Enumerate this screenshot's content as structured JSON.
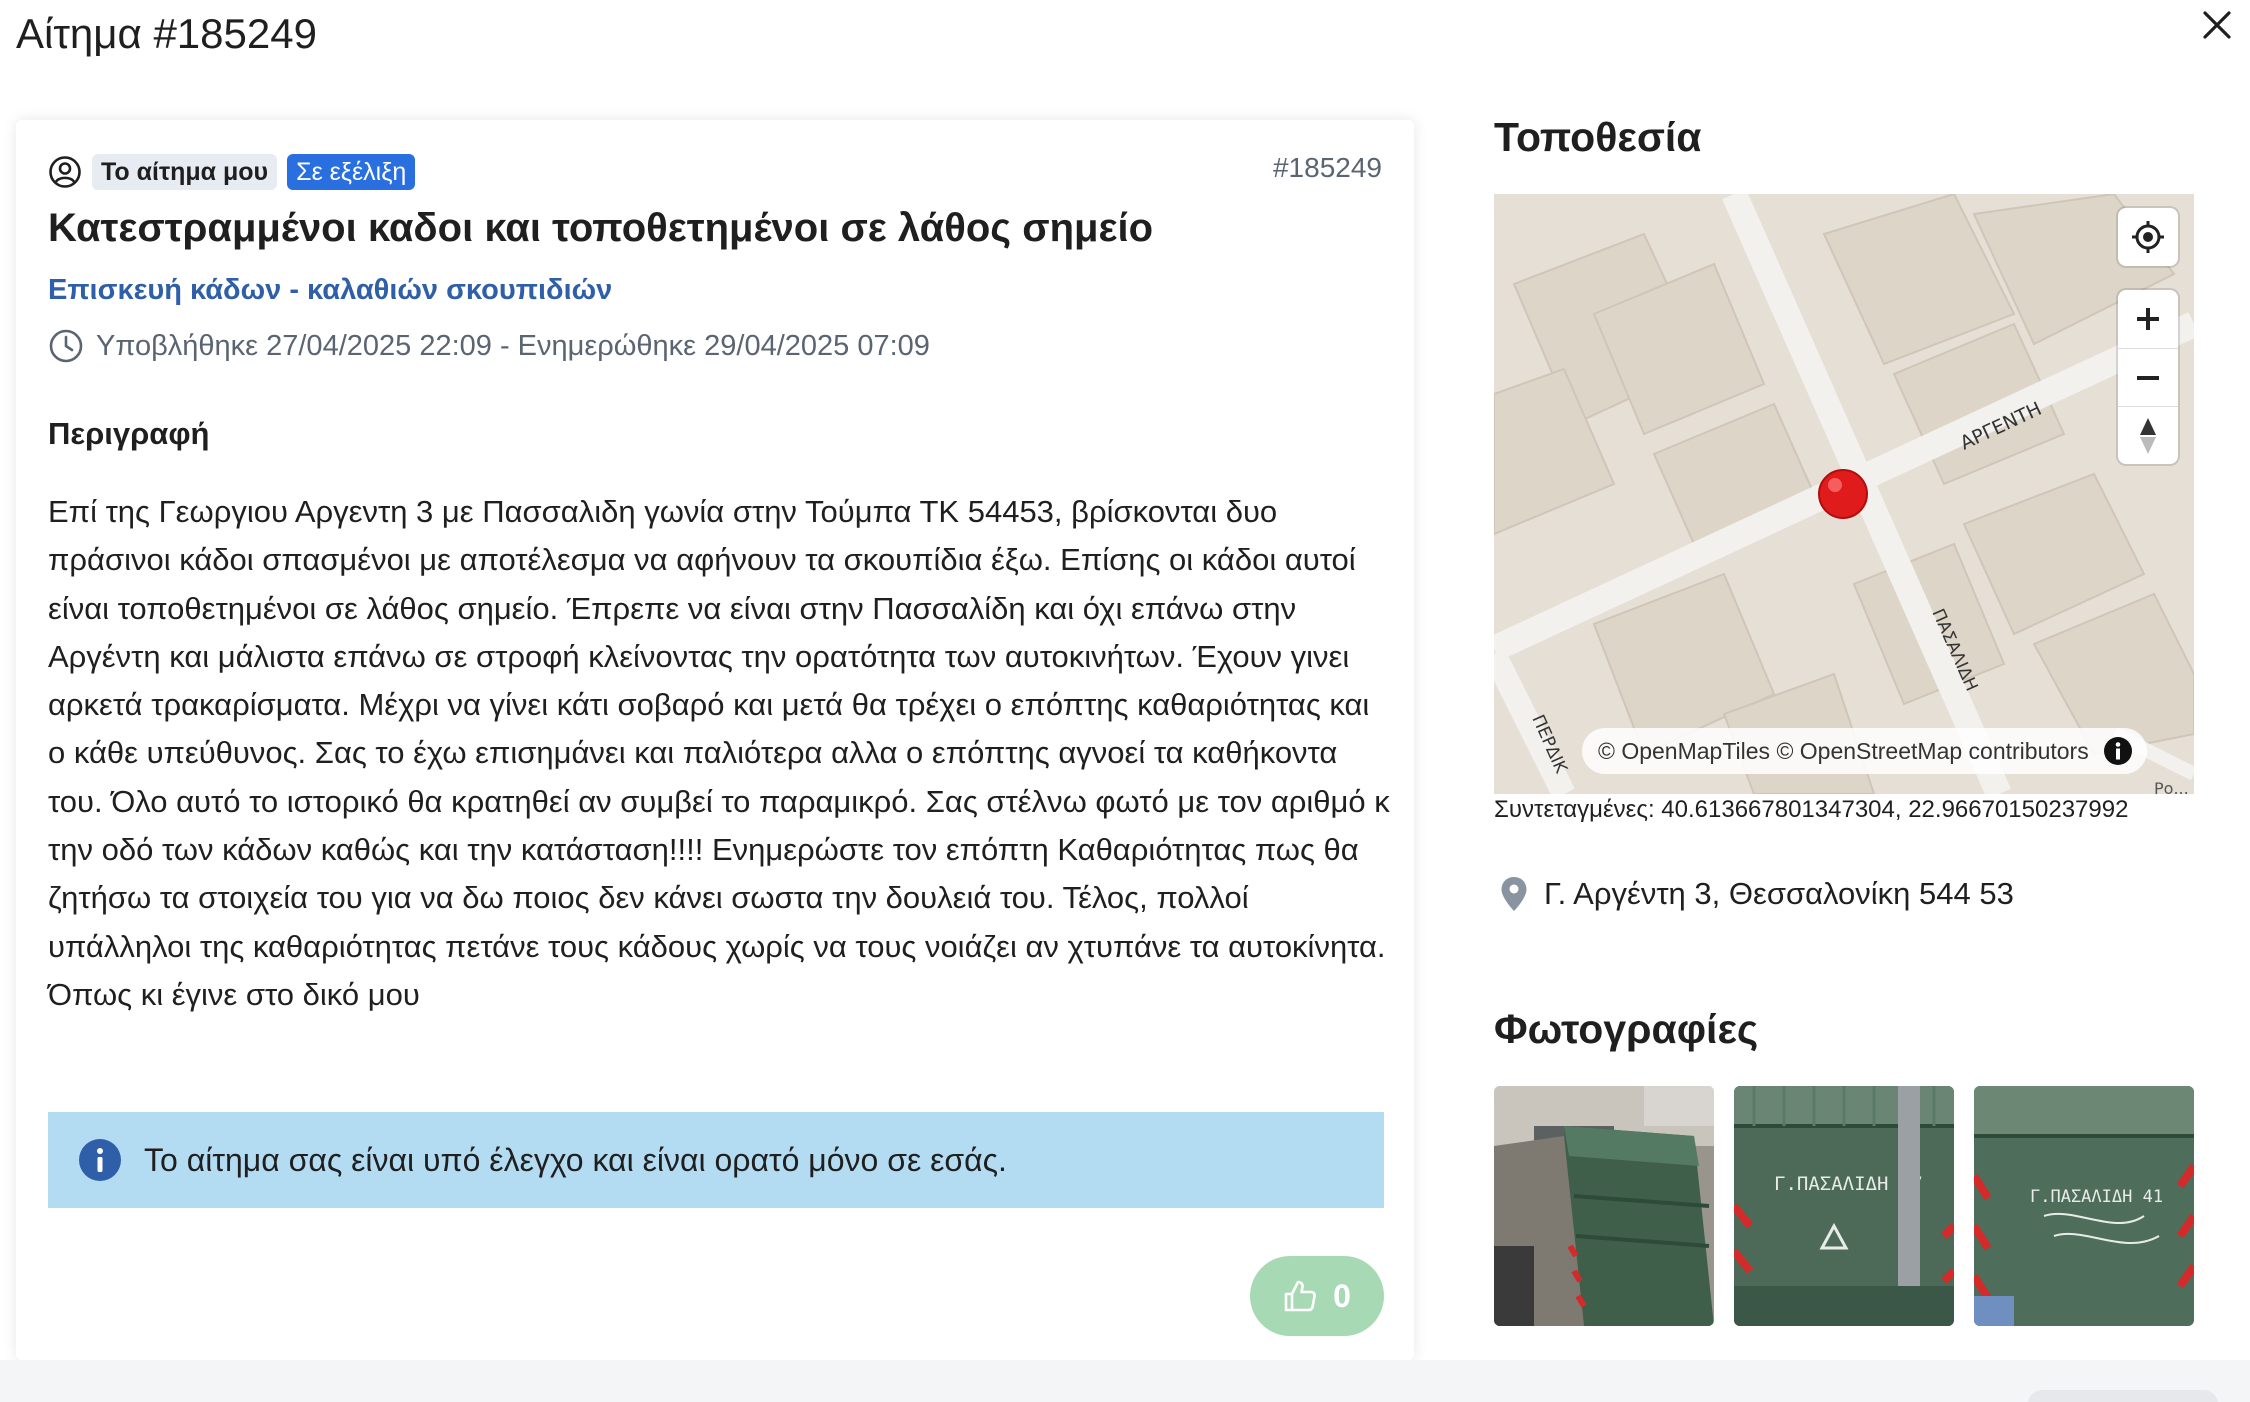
{
  "modal": {
    "title": "Αίτημα #185249"
  },
  "request": {
    "badge_mine": "Το αίτημα μου",
    "badge_status": "Σε εξέλιξη",
    "id_label": "#185249",
    "title": "Κατεστραμμένοι καδοι και τοποθετημένοι σε λάθος σημείο",
    "category": "Επισκευή κάδων - καλαθιών σκουπιδιών",
    "dates": "Υποβλήθηκε 27/04/2025 22:09 - Ενημερώθηκε 29/04/2025 07:09",
    "description_heading": "Περιγραφή",
    "description": "Επί της Γεωργιου Αργεντη 3 με Πασσαλιδη γωνία στην Τούμπα ΤΚ 54453, βρίσκονται δυο πράσινοι κάδοι σπασμένοι με αποτέλεσμα να αφήνουν τα σκουπίδια έξω. Επίσης οι κάδοι αυτοί είναι τοποθετημένοι σε λάθος σημείο. Έπρεπε να είναι στην Πασσαλίδη και όχι επάνω στην Αργέντη και μάλιστα επάνω σε στροφή κλείνοντας την ορατότητα των αυτοκινήτων. Έχουν γινει αρκετά τρακαρίσματα. Μέχρι να γίνει κάτι σοβαρό και μετά θα τρέχει ο επόπτης καθαριότητας και ο κάθε υπεύθυνος. Σας το έχω επισημάνει και παλιότερα αλλα ο επόπτης αγνοεί τα καθήκοντα του. Όλο αυτό το ιστορικό θα κρατηθεί αν συμβεί το παραμικρό. Σας στέλνω φωτό με τον αριθμό κ την οδό των κάδων καθώς και την κατάσταση!!!! Ενημερώστε τον επόπτη Καθαριότητας πως θα ζητήσω τα στοιχεία του για να δω ποιος δεν κάνει σωστα την δουλειά του. Τέλος, πολλοί υπάλληλοι της καθαριότητας πετάνε τους κάδους χωρίς να τους νοιάζει αν χτυπάνε τα αυτοκίνητα. Όπως κι έγινε στο δικό μου",
    "info_message": "Το αίτημα σας είναι υπό έλεγχο και είναι ορατό μόνο σε εσάς.",
    "like_count": "0"
  },
  "location": {
    "heading": "Τοποθεσία",
    "streets": {
      "argenti": "ΑΡΓΕΝΤΗ",
      "pasalidi": "ΠΑΣΑΛΙΔΗ",
      "perdikari": "ΠΕΡΔΙΚ",
      "corner": "Ρο..."
    },
    "attribution": "© OpenMapTiles © OpenStreetMap contributors",
    "coordinates": "Συντεταγμένες: 40.613667801347304, 22.96670150237992",
    "address": "Γ. Αργέντη 3, Θεσσαλονίκη 544 53"
  },
  "photos": {
    "heading": "Φωτογραφίες",
    "items": [
      {
        "label": ""
      },
      {
        "label": "Γ.ΠΑΣΑΛΙΔΗ 37"
      },
      {
        "label": "Γ.ΠΑΣΑΛΙΔΗ 41"
      }
    ]
  },
  "colors": {
    "status_badge": "#2a6fe0",
    "category_link": "#2f5fa8",
    "info_box": "#b3dbf2",
    "like_button": "#a8d9b5",
    "map_marker": "#e01b1b"
  }
}
